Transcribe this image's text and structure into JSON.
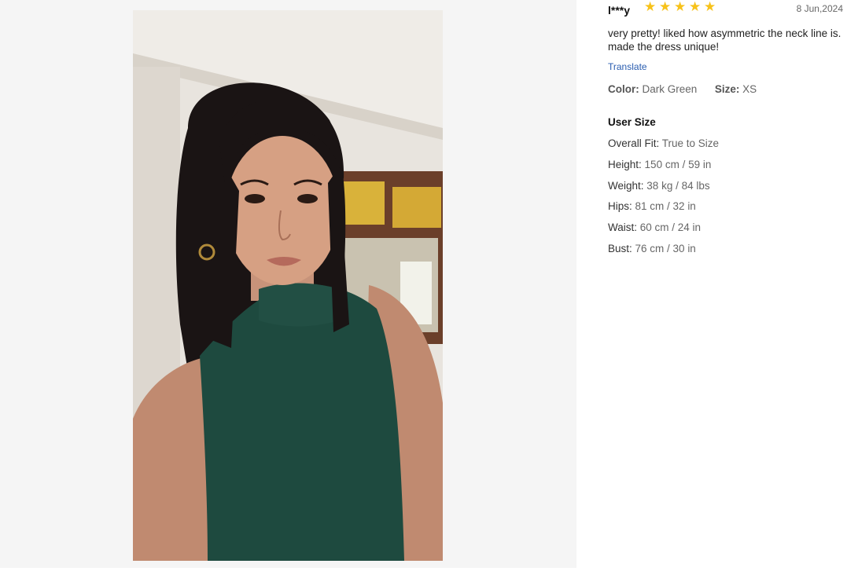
{
  "review": {
    "reviewer": "l***y",
    "rating": 5,
    "star_color": "#f7c21a",
    "date": "8 Jun,2024",
    "text": "very pretty! liked how asymmetric the neck line is. made the dress unique!",
    "translate_label": "Translate",
    "color_label": "Color:",
    "color_value": "Dark Green",
    "size_label": "Size:",
    "size_value": "XS"
  },
  "user_size": {
    "title": "User Size",
    "items": [
      {
        "label": "Overall Fit:",
        "value": "True to Size"
      },
      {
        "label": "Height:",
        "value": "150 cm / 59 in"
      },
      {
        "label": "Weight:",
        "value": "38 kg / 84 lbs"
      },
      {
        "label": "Hips:",
        "value": "81 cm / 32 in"
      },
      {
        "label": "Waist:",
        "value": "60 cm / 24 in"
      },
      {
        "label": "Bust:",
        "value": "76 cm / 30 in"
      }
    ]
  },
  "photo": {
    "dress_color": "#1e4a3f"
  }
}
